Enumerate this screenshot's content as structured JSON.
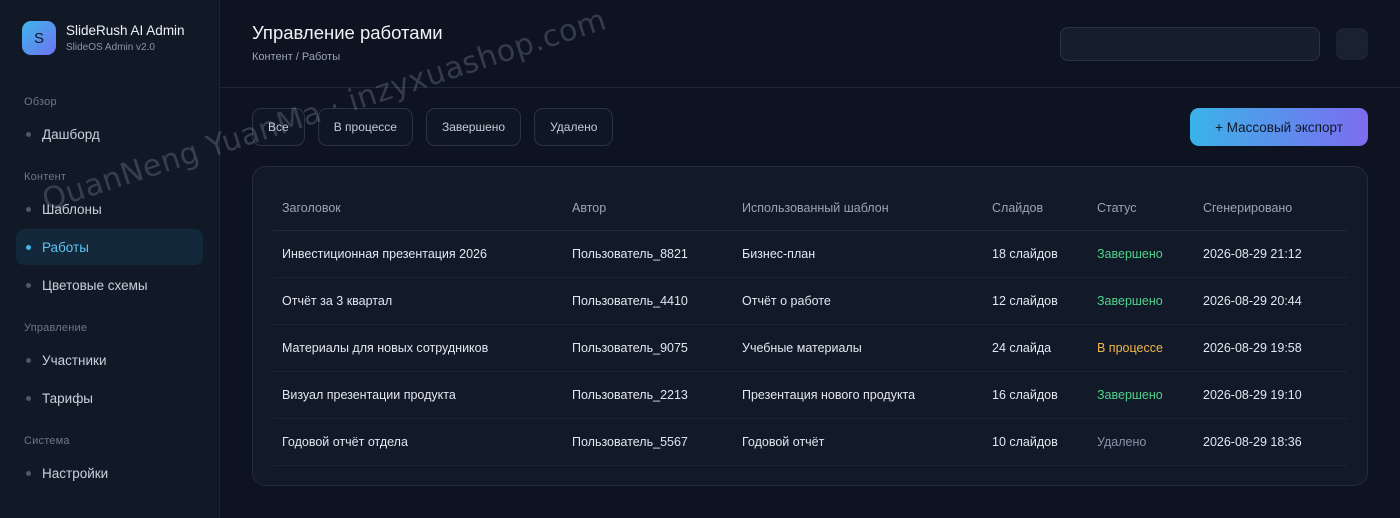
{
  "brand": {
    "logo_letter": "S",
    "title": "SlideRush AI Admin",
    "subtitle": "SlideOS Admin v2.0"
  },
  "sidebar": {
    "sections": [
      {
        "title": "Обзор"
      },
      {
        "title": "Контент"
      },
      {
        "title": "Управление"
      },
      {
        "title": "Система"
      }
    ],
    "items": [
      {
        "label": "Дашборд"
      },
      {
        "label": "Шаблоны"
      },
      {
        "label": "Работы",
        "active": true
      },
      {
        "label": "Цветовые схемы"
      },
      {
        "label": "Участники"
      },
      {
        "label": "Тарифы"
      },
      {
        "label": "Настройки"
      }
    ]
  },
  "header": {
    "title": "Управление работами",
    "breadcrumb": "Контент / Работы",
    "search_value": "",
    "search_placeholder": ""
  },
  "filters": [
    "Все",
    "В процессе",
    "Завершено",
    "Удалено"
  ],
  "export_button": "+ Массовый экспорт",
  "table": {
    "columns": [
      "Заголовок",
      "Автор",
      "Использованный шаблон",
      "Слайдов",
      "Статус",
      "Сгенерировано"
    ],
    "rows": [
      [
        "Инвестиционная презентация 2026",
        "Пользователь_8821",
        "Бизнес-план",
        "18 слайдов",
        "Завершено",
        "2026-08-29 21:12"
      ],
      [
        "Отчёт за 3 квартал",
        "Пользователь_4410",
        "Отчёт о работе",
        "12 слайдов",
        "Завершено",
        "2026-08-29 20:44"
      ],
      [
        "Материалы для новых сотрудников",
        "Пользователь_9075",
        "Учебные материалы",
        "24 слайда",
        "В процессе",
        "2026-08-29 19:58"
      ],
      [
        "Визуал презентации продукта",
        "Пользователь_2213",
        "Презентация нового продукта",
        "16 слайдов",
        "Завершено",
        "2026-08-29 19:10"
      ],
      [
        "Годовой отчёт отдела",
        "Пользователь_5567",
        "Годовой отчёт",
        "10 слайдов",
        "Удалено",
        "2026-08-29 18:36"
      ]
    ]
  },
  "status_colors": {
    "Завершено": "#4fd18b",
    "В процессе": "#f0b74a",
    "Удалено": "#8a94a6"
  },
  "watermark": "QuanNeng YuanMa · inzyxuashop.com"
}
